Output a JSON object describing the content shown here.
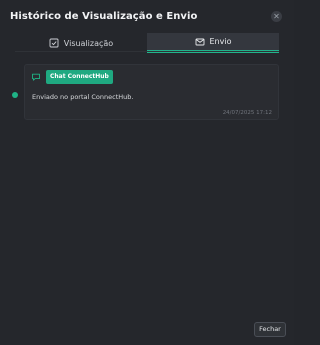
{
  "modal": {
    "title": "Histórico de Visualização e Envio",
    "close_icon": "close-icon"
  },
  "tabs": [
    {
      "label": "Visualização",
      "icon": "eye-doc-icon",
      "active": false
    },
    {
      "label": "Envio",
      "icon": "mail-send-icon",
      "active": true
    }
  ],
  "timeline": {
    "entries": [
      {
        "channel_icon": "chat-bubble-icon",
        "badge": "Chat ConnectHub",
        "message": "Enviado no portal ConnectHub.",
        "timestamp": "24/07/2025 17:12"
      }
    ]
  },
  "footer": {
    "close_label": "Fechar"
  },
  "colors": {
    "accent": "#1fa981",
    "background": "#25272c",
    "tab_active_bg": "#34373e"
  }
}
